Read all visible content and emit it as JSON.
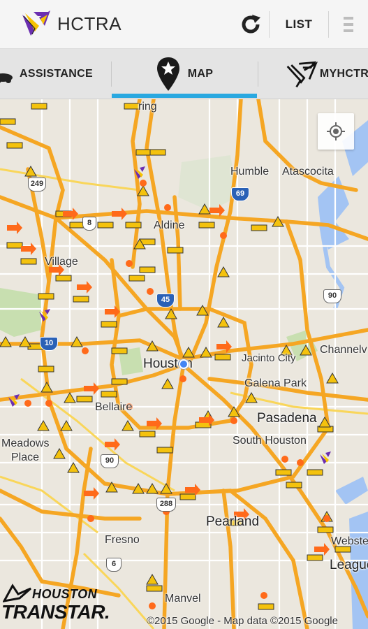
{
  "app": {
    "title": "HCTRA",
    "list_label": "LIST"
  },
  "tabs": [
    {
      "label": "ASSISTANCE"
    },
    {
      "label": "MAP",
      "active": true
    },
    {
      "label": "MYHCTRA"
    }
  ],
  "colors": {
    "accent": "#29a8e0",
    "highway": "#f5a623",
    "incident_orange": "#ff6a1a",
    "construction_yellow": "#f4c20d",
    "water": "#a3c4f3",
    "park": "#c8dfb0"
  },
  "map": {
    "places": [
      {
        "key": "spring",
        "name": "ring"
      },
      {
        "key": "humble",
        "name": "Humble"
      },
      {
        "key": "atascocita",
        "name": "Atascocita"
      },
      {
        "key": "aldine",
        "name": "Aldine"
      },
      {
        "key": "village",
        "name": "Village"
      },
      {
        "key": "houston",
        "name": "Houston"
      },
      {
        "key": "jacinto",
        "name": "Jacinto City"
      },
      {
        "key": "galena",
        "name": "Galena Park"
      },
      {
        "key": "channelview",
        "name": "Channelv"
      },
      {
        "key": "bellaire",
        "name": "Bellaire"
      },
      {
        "key": "pasadena",
        "name": "Pasadena"
      },
      {
        "key": "meadows",
        "name": "Meadows"
      },
      {
        "key": "place",
        "name": "Place"
      },
      {
        "key": "south_houston",
        "name": "South Houston"
      },
      {
        "key": "pearland",
        "name": "Pearland"
      },
      {
        "key": "fresno",
        "name": "Fresno"
      },
      {
        "key": "manvel",
        "name": "Manvel"
      },
      {
        "key": "webster",
        "name": "Webster"
      },
      {
        "key": "league",
        "name": "League"
      }
    ],
    "route_shields": [
      {
        "key": "r249",
        "label": "249"
      },
      {
        "key": "r8",
        "label": "8"
      },
      {
        "key": "i69",
        "label": "69"
      },
      {
        "key": "i45",
        "label": "45"
      },
      {
        "key": "i10",
        "label": "10"
      },
      {
        "key": "r90",
        "label": "90"
      },
      {
        "key": "alt90",
        "label": "90"
      },
      {
        "key": "r288",
        "label": "288"
      },
      {
        "key": "r6",
        "label": "6"
      }
    ],
    "copyright": "©2015 Google - Map data ©2015 Google",
    "branding": {
      "line1": "HOUSTON",
      "line2": "TRANSTAR."
    },
    "locate_icon": "crosshair-icon"
  }
}
